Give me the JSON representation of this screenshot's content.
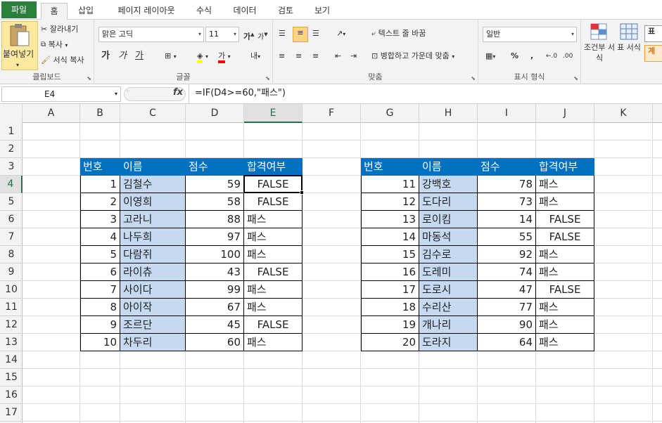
{
  "tabs": [
    "파일",
    "홈",
    "삽입",
    "페이지 레이아웃",
    "수식",
    "데이터",
    "검토",
    "보기"
  ],
  "clipboard": {
    "paste": "붙여넣기",
    "cut": "잘라내기",
    "copy": "복사",
    "format_painter": "서식 복사",
    "group": "클립보드"
  },
  "font": {
    "name": "맑은 고딕",
    "size": "11",
    "group": "글꼴",
    "bold": "가",
    "italic": "가",
    "underline": "가"
  },
  "alignment": {
    "wrap": "텍스트 줄 바꿈",
    "merge": "병합하고 가운데 맞춤",
    "group": "맞춤"
  },
  "number": {
    "format": "일반",
    "percent": "%",
    "comma": ",",
    "group": "표시 형식"
  },
  "styles": {
    "conditional": "조건부 서식",
    "table": "표 서식",
    "cell_style_1": "표",
    "cell_style_2": "계"
  },
  "name_box": "E4",
  "formula": "=IF(D4>=60,\"패스\")",
  "fx": "fx",
  "columns": [
    "A",
    "B",
    "C",
    "D",
    "E",
    "F",
    "G",
    "H",
    "I",
    "J",
    "K"
  ],
  "rows": [
    "1",
    "2",
    "3",
    "4",
    "5",
    "6",
    "7",
    "8",
    "9",
    "10",
    "11",
    "12",
    "13",
    "14",
    "15",
    "16",
    "17"
  ],
  "table1": {
    "headers": [
      "번호",
      "이름",
      "점수",
      "합격여부"
    ],
    "rows": [
      [
        "1",
        "김철수",
        "59",
        "FALSE"
      ],
      [
        "2",
        "이영희",
        "58",
        "FALSE"
      ],
      [
        "3",
        "고라니",
        "88",
        "패스"
      ],
      [
        "4",
        "나두희",
        "97",
        "패스"
      ],
      [
        "5",
        "다람쥐",
        "100",
        "패스"
      ],
      [
        "6",
        "라이츄",
        "43",
        "FALSE"
      ],
      [
        "7",
        "사이다",
        "99",
        "패스"
      ],
      [
        "8",
        "아이작",
        "67",
        "패스"
      ],
      [
        "9",
        "조르단",
        "45",
        "FALSE"
      ],
      [
        "10",
        "차두리",
        "60",
        "패스"
      ]
    ]
  },
  "table2": {
    "headers": [
      "번호",
      "이름",
      "점수",
      "합격여부"
    ],
    "rows": [
      [
        "11",
        "강백호",
        "78",
        "패스"
      ],
      [
        "12",
        "도다리",
        "73",
        "패스"
      ],
      [
        "13",
        "로이킴",
        "14",
        "FALSE"
      ],
      [
        "14",
        "마동석",
        "55",
        "FALSE"
      ],
      [
        "15",
        "김수로",
        "92",
        "패스"
      ],
      [
        "16",
        "도레미",
        "74",
        "패스"
      ],
      [
        "17",
        "도로시",
        "47",
        "FALSE"
      ],
      [
        "18",
        "수리산",
        "77",
        "패스"
      ],
      [
        "19",
        "개나리",
        "90",
        "패스"
      ],
      [
        "20",
        "도라지",
        "64",
        "패스"
      ]
    ]
  },
  "colors": {
    "header": "#0070c0",
    "name_fill": "#c5d9f1",
    "accent": "#217346"
  }
}
